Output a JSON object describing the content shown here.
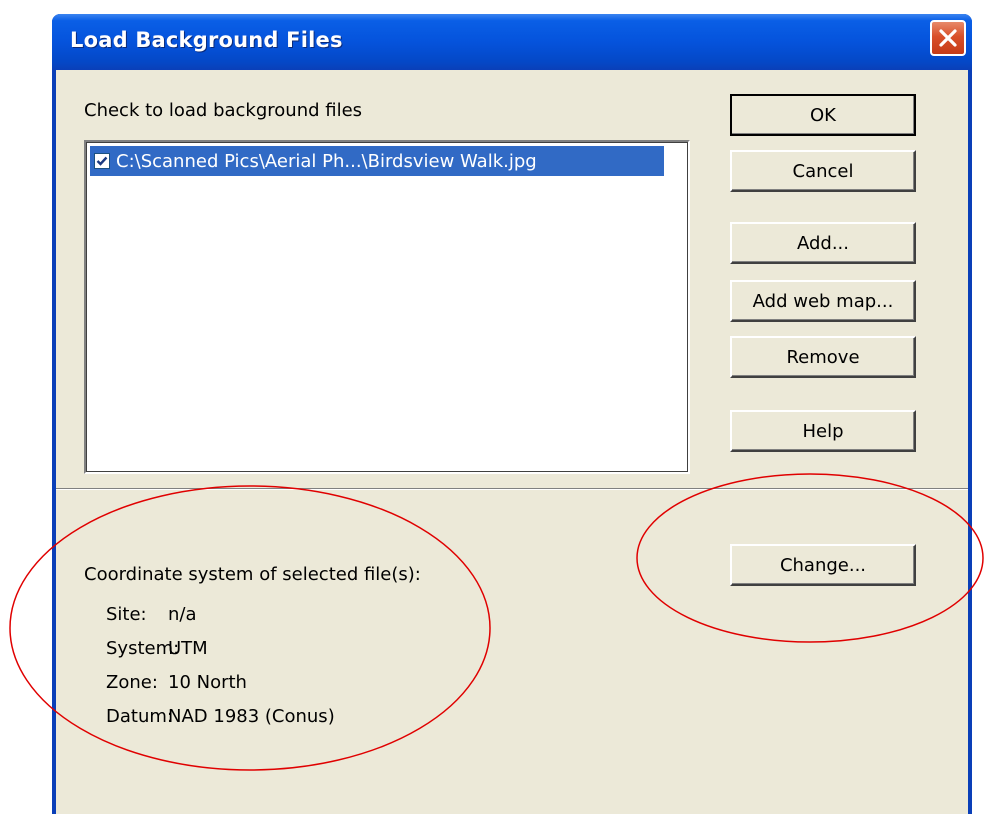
{
  "window": {
    "title": "Load Background Files"
  },
  "dialog": {
    "list_label": "Check to load background files",
    "files": [
      {
        "path": "C:\\Scanned Pics\\Aerial Ph...\\Birdsview Walk.jpg",
        "checked": true,
        "selected": true
      }
    ]
  },
  "buttons": {
    "ok": "OK",
    "cancel": "Cancel",
    "add": "Add...",
    "add_web_map": "Add web map...",
    "remove": "Remove",
    "help": "Help",
    "change": "Change..."
  },
  "coordinates": {
    "heading": "Coordinate system of selected file(s):",
    "rows": [
      {
        "key": "Site:",
        "value": "n/a"
      },
      {
        "key": "System:",
        "value": "UTM"
      },
      {
        "key": "Zone:",
        "value": "10 North"
      },
      {
        "key": "Datum:",
        "value": "NAD 1983 (Conus)"
      }
    ]
  },
  "colors": {
    "title_bar": "#0553dc",
    "selection": "#316ac5",
    "dialog_face": "#ece9d8",
    "annotation": "#e00000"
  },
  "icons": {
    "close": "close-x-icon",
    "checkbox": "checkmark-icon"
  }
}
